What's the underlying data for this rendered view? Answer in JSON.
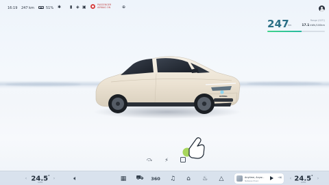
{
  "status_bar": {
    "time": "16:19",
    "range_short": "247 km",
    "battery_pct": "51%",
    "passenger_airbag_line1": "PASSENGER",
    "passenger_airbag_line2": "AIRBAG ON"
  },
  "range_widget": {
    "value": "247",
    "unit": "km",
    "caption": "Range (CLTC)",
    "detail_value": "17.1",
    "detail_unit": "kWh/100km",
    "fill_fraction": 0.6,
    "accent": "#2b6f86"
  },
  "car": {
    "color": "#ece4d4",
    "model_badge": "XPENG"
  },
  "shortcuts": [
    {
      "name": "trunk-icon",
      "glyph": "⤼"
    },
    {
      "name": "charge-port-icon",
      "glyph": "⚡"
    },
    {
      "name": "door-lock-icon",
      "glyph": "🔒"
    }
  ],
  "dock": {
    "left_temp": "24.5",
    "left_temp_unit": "°",
    "left_temp_sub": "AUTO",
    "right_temp": "24.5",
    "right_temp_unit": "°",
    "right_temp_sub": "AUTO",
    "volume_icon": "volume-icon",
    "apps_icon": "apps-grid-icon",
    "car_icon": "car-icon",
    "camera_label": "360",
    "music_icon": "music-note-icon",
    "home_icon": "home-icon",
    "climate_icon": "climate-icon",
    "navigation_icon": "navigation-arrow-icon",
    "media_title": "Anytime, Anyw...",
    "media_subtitle": "Netease Music"
  }
}
